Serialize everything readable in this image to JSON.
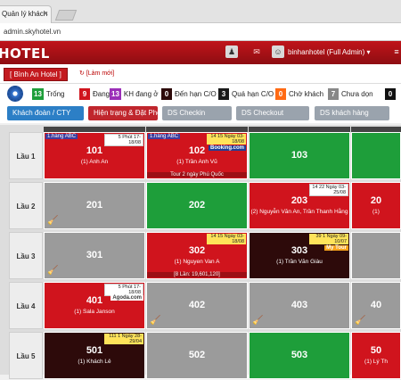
{
  "browser": {
    "tab_title": "Quản lý khách",
    "tab_close": "×",
    "url": "admin.skyhotel.vn"
  },
  "app": {
    "logo": "HOTEL",
    "user": "binhanhotel (Full Admin) ▾"
  },
  "hotel": {
    "name": "[ Bình An Hotel ]",
    "refresh": "[Làm mới]"
  },
  "legend": [
    {
      "count": "13",
      "label": "Trống",
      "color": "#1e9e3a"
    },
    {
      "count": "9",
      "label": "Đang ở",
      "color": "#d0141d"
    },
    {
      "count": "13",
      "label": "KH đang ở",
      "color": "#9b2fb8"
    },
    {
      "count": "0",
      "label": "Đến hạn C/O",
      "color": "#2d0a0a"
    },
    {
      "count": "3",
      "label": "Quá hạn C/O",
      "color": "#1a1a1a"
    },
    {
      "count": "0",
      "label": "Chờ khách",
      "color": "#ff6a13"
    },
    {
      "count": "7",
      "label": "Chưa dọn",
      "color": "#888888"
    },
    {
      "count": "0",
      "label": "",
      "color": "#111111"
    }
  ],
  "buttons": [
    {
      "label": "Khách đoàn / CTY",
      "color": "#2c7fc6"
    },
    {
      "label": "Hiện trạng & Đặt Phòng",
      "color": "#c0262d"
    },
    {
      "label": "DS Checkin",
      "color": "#9aa3ad"
    },
    {
      "label": "DS Checkout",
      "color": "#9aa3ad"
    },
    {
      "label": "DS khách hàng",
      "color": "#9aa3ad"
    }
  ],
  "floors": [
    {
      "label": "Lầu 1",
      "rooms": [
        {
          "num": "101",
          "color": "#d0141d",
          "guest": "(1) Anh An",
          "tag": "1.hàng ABC",
          "time": "5 Phút 17-18/08",
          "time_style": "white"
        },
        {
          "num": "102",
          "color": "#d0141d",
          "guest": "(1) Trần Anh Vũ",
          "tag": "1.hàng ABC",
          "time": "14 15 Ngày 03-18/08",
          "time_style": "yellow",
          "source": "Booking.com",
          "source_color": "#1f3f96",
          "tour": "Tour 2 ngày Phú Quốc"
        },
        {
          "num": "103",
          "color": "#1e9e3a"
        },
        {
          "num": "",
          "color": "#1e9e3a"
        }
      ]
    },
    {
      "label": "Lầu 2",
      "rooms": [
        {
          "num": "201",
          "color": "#9b9b9b",
          "dirty": true
        },
        {
          "num": "202",
          "color": "#1e9e3a"
        },
        {
          "num": "203",
          "color": "#d0141d",
          "guest": "(2) Nguyễn Văn An, Trần Thanh Hằng",
          "time": "14 22 Ngày 03-25/08",
          "time_style": "white"
        },
        {
          "num": "20",
          "color": "#d0141d",
          "guest": "(1)"
        }
      ]
    },
    {
      "label": "Lầu 3",
      "rooms": [
        {
          "num": "301",
          "color": "#9b9b9b",
          "dirty": true
        },
        {
          "num": "302",
          "color": "#d0141d",
          "guest": "(1) Nguyen Van A",
          "time": "14 15 Ngày 03-18/08",
          "time_style": "yellow",
          "tour": "[8 Lần: 19,601,120]"
        },
        {
          "num": "303",
          "color": "#2d0a0a",
          "guest": "(1) Trần Văn Giàu",
          "time": "39 1 Ngày 09-10/07",
          "time_style": "yellow",
          "source": "My Tour",
          "source_color": "#f6a21a"
        },
        {
          "num": "",
          "color": "#9b9b9b"
        }
      ]
    },
    {
      "label": "Lầu 4",
      "rooms": [
        {
          "num": "401",
          "color": "#d0141d",
          "guest": "(1) Sala Janson",
          "time": "5 Phút 17-18/08",
          "time_style": "white",
          "source": "Agoda.com",
          "source_color": "#3b3b3b"
        },
        {
          "num": "402",
          "color": "#9b9b9b",
          "dirty": true
        },
        {
          "num": "403",
          "color": "#9b9b9b",
          "dirty": true
        },
        {
          "num": "40",
          "color": "#9b9b9b",
          "dirty": true
        }
      ]
    },
    {
      "label": "Lầu 5",
      "rooms": [
        {
          "num": "501",
          "color": "#2d0a0a",
          "guest": "(1) Khách Lẻ",
          "time": "111 1 Ngày 28-29/04",
          "time_style": "yellow"
        },
        {
          "num": "502",
          "color": "#9b9b9b"
        },
        {
          "num": "503",
          "color": "#1e9e3a"
        },
        {
          "num": "50",
          "color": "#d0141d",
          "guest": "(1) Lý Th"
        }
      ]
    }
  ]
}
